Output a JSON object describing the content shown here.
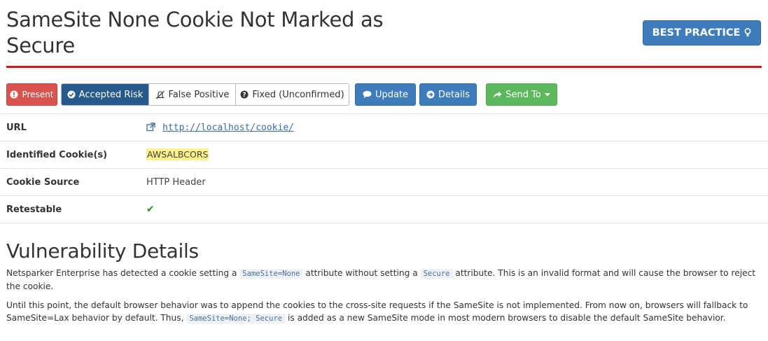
{
  "header": {
    "title": "SameSite None Cookie Not Marked as Secure",
    "severity_label": "BEST PRACTICE",
    "severity_icon": "lightbulb-icon",
    "rule_color": "#cc1a1a"
  },
  "actions": {
    "present": {
      "label": "Present",
      "icon": "exclamation-circle-icon",
      "color": "#d9534f"
    },
    "status_group": [
      {
        "label": "Accepted Risk",
        "icon": "check-circle-icon",
        "active": true
      },
      {
        "label": "False Positive",
        "icon": "bell-slash-icon",
        "active": false
      },
      {
        "label": "Fixed (Unconfirmed)",
        "icon": "question-circle-icon",
        "active": false
      }
    ],
    "update": {
      "label": "Update",
      "icon": "comment-icon"
    },
    "details": {
      "label": "Details",
      "icon": "arrow-circle-right-icon"
    },
    "send_to": {
      "label": "Send To",
      "icon": "share-icon",
      "color": "#5cb85c"
    }
  },
  "properties": [
    {
      "key": "URL",
      "value": "http://localhost/cookie/"
    },
    {
      "key": "Identified Cookie(s)",
      "value": "AWSALBCORS"
    },
    {
      "key": "Cookie Source",
      "value": "HTTP Header"
    },
    {
      "key": "Retestable",
      "value": "✔"
    }
  ],
  "vulnerability": {
    "heading": "Vulnerability Details",
    "p1_a": "Netsparker Enterprise has detected a cookie setting a ",
    "p1_code1": "SameSite=None",
    "p1_b": " attribute without setting a ",
    "p1_code2": "Secure",
    "p1_c": " attribute. This is an invalid format and will cause the browser to reject the cookie.",
    "p2_a": "Until this point, the default browser behavior was to append the cookies to the cross-site requests if the SameSite is not implemented. From now on, browsers will fallback to SameSite=Lax behavior by default. Thus, ",
    "p2_code": "SameSite=None; Secure",
    "p2_b": " is added as a new SameSite mode in most modern browsers to disable the default SameSite behavior."
  }
}
